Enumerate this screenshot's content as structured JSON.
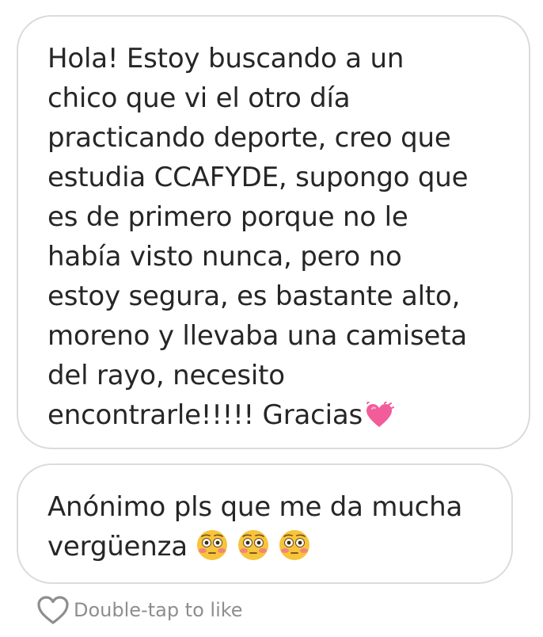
{
  "messages": [
    {
      "text": "Hola! Estoy buscando a un\nchico que vi el otro día\npracticando deporte, creo que\nestudia CCAFYDE, supongo que\nes de primero porque no le\nhabía visto nunca, pero no\nestoy segura, es bastante alto,\nmoreno y llevaba una camiseta\ndel rayo, necesito\nencontrarle!!!!! Gracias",
      "trailing_emoji": "growing-heart-icon"
    },
    {
      "text": "Anónimo pls que me da mucha\nvergüenza",
      "trailing_emojis": [
        "flushed-face-icon",
        "flushed-face-icon",
        "flushed-face-icon"
      ]
    }
  ],
  "like": {
    "icon": "heart-outline-icon",
    "label": "Double-tap to like"
  },
  "colors": {
    "bubble_border": "#dbdbdb",
    "text": "#262626",
    "secondary_text": "#8e8e8e",
    "heart_pink": "#f25c9a"
  }
}
